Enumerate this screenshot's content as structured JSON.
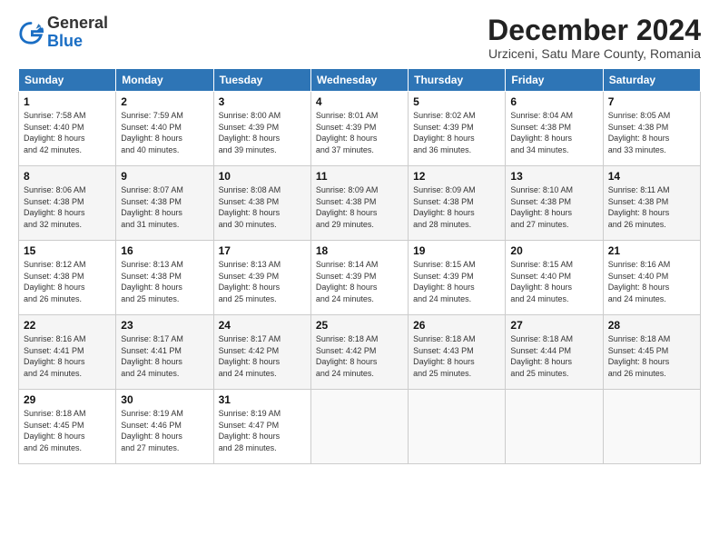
{
  "logo": {
    "general": "General",
    "blue": "Blue"
  },
  "header": {
    "title": "December 2024",
    "subtitle": "Urziceni, Satu Mare County, Romania"
  },
  "days_of_week": [
    "Sunday",
    "Monday",
    "Tuesday",
    "Wednesday",
    "Thursday",
    "Friday",
    "Saturday"
  ],
  "weeks": [
    [
      {
        "day": "1",
        "info": "Sunrise: 7:58 AM\nSunset: 4:40 PM\nDaylight: 8 hours\nand 42 minutes."
      },
      {
        "day": "2",
        "info": "Sunrise: 7:59 AM\nSunset: 4:40 PM\nDaylight: 8 hours\nand 40 minutes."
      },
      {
        "day": "3",
        "info": "Sunrise: 8:00 AM\nSunset: 4:39 PM\nDaylight: 8 hours\nand 39 minutes."
      },
      {
        "day": "4",
        "info": "Sunrise: 8:01 AM\nSunset: 4:39 PM\nDaylight: 8 hours\nand 37 minutes."
      },
      {
        "day": "5",
        "info": "Sunrise: 8:02 AM\nSunset: 4:39 PM\nDaylight: 8 hours\nand 36 minutes."
      },
      {
        "day": "6",
        "info": "Sunrise: 8:04 AM\nSunset: 4:38 PM\nDaylight: 8 hours\nand 34 minutes."
      },
      {
        "day": "7",
        "info": "Sunrise: 8:05 AM\nSunset: 4:38 PM\nDaylight: 8 hours\nand 33 minutes."
      }
    ],
    [
      {
        "day": "8",
        "info": "Sunrise: 8:06 AM\nSunset: 4:38 PM\nDaylight: 8 hours\nand 32 minutes."
      },
      {
        "day": "9",
        "info": "Sunrise: 8:07 AM\nSunset: 4:38 PM\nDaylight: 8 hours\nand 31 minutes."
      },
      {
        "day": "10",
        "info": "Sunrise: 8:08 AM\nSunset: 4:38 PM\nDaylight: 8 hours\nand 30 minutes."
      },
      {
        "day": "11",
        "info": "Sunrise: 8:09 AM\nSunset: 4:38 PM\nDaylight: 8 hours\nand 29 minutes."
      },
      {
        "day": "12",
        "info": "Sunrise: 8:09 AM\nSunset: 4:38 PM\nDaylight: 8 hours\nand 28 minutes."
      },
      {
        "day": "13",
        "info": "Sunrise: 8:10 AM\nSunset: 4:38 PM\nDaylight: 8 hours\nand 27 minutes."
      },
      {
        "day": "14",
        "info": "Sunrise: 8:11 AM\nSunset: 4:38 PM\nDaylight: 8 hours\nand 26 minutes."
      }
    ],
    [
      {
        "day": "15",
        "info": "Sunrise: 8:12 AM\nSunset: 4:38 PM\nDaylight: 8 hours\nand 26 minutes."
      },
      {
        "day": "16",
        "info": "Sunrise: 8:13 AM\nSunset: 4:38 PM\nDaylight: 8 hours\nand 25 minutes."
      },
      {
        "day": "17",
        "info": "Sunrise: 8:13 AM\nSunset: 4:39 PM\nDaylight: 8 hours\nand 25 minutes."
      },
      {
        "day": "18",
        "info": "Sunrise: 8:14 AM\nSunset: 4:39 PM\nDaylight: 8 hours\nand 24 minutes."
      },
      {
        "day": "19",
        "info": "Sunrise: 8:15 AM\nSunset: 4:39 PM\nDaylight: 8 hours\nand 24 minutes."
      },
      {
        "day": "20",
        "info": "Sunrise: 8:15 AM\nSunset: 4:40 PM\nDaylight: 8 hours\nand 24 minutes."
      },
      {
        "day": "21",
        "info": "Sunrise: 8:16 AM\nSunset: 4:40 PM\nDaylight: 8 hours\nand 24 minutes."
      }
    ],
    [
      {
        "day": "22",
        "info": "Sunrise: 8:16 AM\nSunset: 4:41 PM\nDaylight: 8 hours\nand 24 minutes."
      },
      {
        "day": "23",
        "info": "Sunrise: 8:17 AM\nSunset: 4:41 PM\nDaylight: 8 hours\nand 24 minutes."
      },
      {
        "day": "24",
        "info": "Sunrise: 8:17 AM\nSunset: 4:42 PM\nDaylight: 8 hours\nand 24 minutes."
      },
      {
        "day": "25",
        "info": "Sunrise: 8:18 AM\nSunset: 4:42 PM\nDaylight: 8 hours\nand 24 minutes."
      },
      {
        "day": "26",
        "info": "Sunrise: 8:18 AM\nSunset: 4:43 PM\nDaylight: 8 hours\nand 25 minutes."
      },
      {
        "day": "27",
        "info": "Sunrise: 8:18 AM\nSunset: 4:44 PM\nDaylight: 8 hours\nand 25 minutes."
      },
      {
        "day": "28",
        "info": "Sunrise: 8:18 AM\nSunset: 4:45 PM\nDaylight: 8 hours\nand 26 minutes."
      }
    ],
    [
      {
        "day": "29",
        "info": "Sunrise: 8:18 AM\nSunset: 4:45 PM\nDaylight: 8 hours\nand 26 minutes."
      },
      {
        "day": "30",
        "info": "Sunrise: 8:19 AM\nSunset: 4:46 PM\nDaylight: 8 hours\nand 27 minutes."
      },
      {
        "day": "31",
        "info": "Sunrise: 8:19 AM\nSunset: 4:47 PM\nDaylight: 8 hours\nand 28 minutes."
      },
      {
        "day": "",
        "info": ""
      },
      {
        "day": "",
        "info": ""
      },
      {
        "day": "",
        "info": ""
      },
      {
        "day": "",
        "info": ""
      }
    ]
  ]
}
